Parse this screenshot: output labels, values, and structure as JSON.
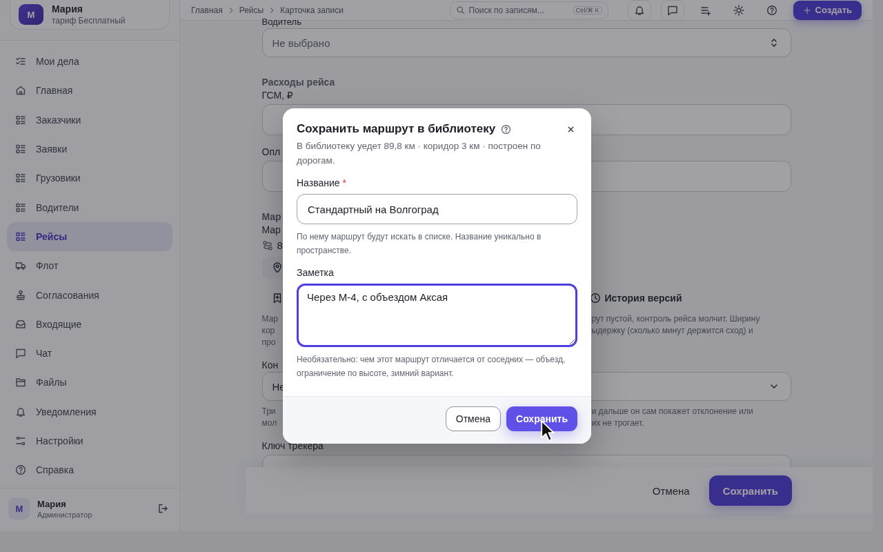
{
  "sidebar": {
    "account": {
      "avatar": "М",
      "name": "Мария",
      "plan": "тариф Бесплатный"
    },
    "items": [
      {
        "label": "Мои дела",
        "kind": "checklist",
        "selected": false
      },
      {
        "label": "Главная",
        "kind": "home",
        "selected": false
      },
      {
        "label": "Заказчики",
        "kind": "list",
        "selected": false
      },
      {
        "label": "Заявки",
        "kind": "list",
        "selected": false
      },
      {
        "label": "Грузовики",
        "kind": "list",
        "selected": false
      },
      {
        "label": "Водители",
        "kind": "list",
        "selected": false
      },
      {
        "label": "Рейсы",
        "kind": "list",
        "selected": true
      },
      {
        "label": "Флот",
        "kind": "truck",
        "selected": false
      },
      {
        "label": "Согласования",
        "kind": "stamp",
        "selected": false
      },
      {
        "label": "Входящие",
        "kind": "inbox",
        "selected": false
      },
      {
        "label": "Чат",
        "kind": "chat",
        "selected": false
      },
      {
        "label": "Файлы",
        "kind": "folder",
        "selected": false
      },
      {
        "label": "Уведомления",
        "kind": "bell",
        "selected": false
      },
      {
        "label": "Настройки",
        "kind": "sliders",
        "selected": false
      },
      {
        "label": "Справка",
        "kind": "help",
        "selected": false
      }
    ],
    "user": {
      "avatar": "М",
      "name": "Мария",
      "role": "Администратор"
    }
  },
  "topbar": {
    "breadcrumbs": [
      "Главная",
      "Рейсы",
      "Карточка записи"
    ],
    "search": {
      "placeholder": "Поиск по записям...",
      "shortcut": "Ctrl/⌘ K"
    },
    "create_button": "Создать"
  },
  "form": {
    "driver": {
      "label": "Водитель",
      "placeholder": "Не выбрано"
    },
    "expenses": {
      "heading": "Расходы рейса",
      "fuel_label": "ГСМ, ₽"
    },
    "payment_label": "Опл",
    "route": {
      "heading": "Мар",
      "label": "Мар",
      "distance": "8"
    },
    "version_history": "История версий",
    "route_note": {
      "left": [
        "Мар",
        "кор",
        "про"
      ],
      "right": [
        "рут пустой, контроль рейса молчит. Ширину",
        "ыдержку (сколько минут держится сход) и"
      ]
    },
    "control": {
      "label": "Кон",
      "value": "Не"
    },
    "control_note": {
      "left": [
        "Три",
        "мол"
      ],
      "right": [
        "и дальше он сам покажет отклонение или",
        "их не трогает."
      ]
    },
    "tracker_label": "Ключ трекера"
  },
  "footer": {
    "cancel": "Отмена",
    "save": "Сохранить"
  },
  "dialog": {
    "title": "Сохранить маршрут в библиотеку",
    "description": "В библиотеку уедет 89,8 км · коридор 3 км · построен по дорогам.",
    "fields": [
      {
        "kind": "input",
        "label": "Название",
        "required_mark": "*",
        "value": "Стандартный на Волгоград",
        "hint": "По нему маршрут будут искать в списке. Название уникально в пространстве.",
        "focused": false
      },
      {
        "kind": "textarea",
        "label": "Заметка",
        "value": "Через М-4, с объездом Аксая",
        "hint": "Необязательно: чем этот маршрут отличается от соседних — объезд, ограничение по высоте, зимний вариант.",
        "focused": true
      }
    ],
    "buttons": [
      {
        "label": "Отмена",
        "kind": "secondary"
      },
      {
        "label": "Сохранить",
        "kind": "primary"
      }
    ]
  }
}
